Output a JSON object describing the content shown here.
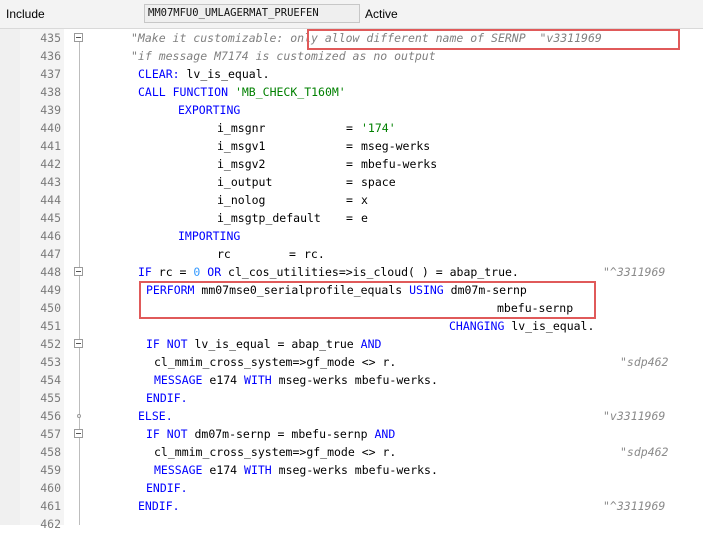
{
  "header": {
    "label": "Include",
    "include_name": "MM07MFU0_UMLAGERMAT_PRUEFEN",
    "status": "Active"
  },
  "colors": {
    "keyword": "#0000ff",
    "string": "#008000",
    "number": "#3399ff",
    "comment": "#808080",
    "highlight": "#e05a5a"
  },
  "editor": {
    "lines": [
      {
        "num": "435",
        "comment": "\"Make it customizable: only allow different name of SERNP  \"v3311969"
      },
      {
        "num": "436",
        "comment": "\"if message M7174 is customized as no output"
      },
      {
        "num": "437",
        "kw1": "CLEAR:",
        "rest": " lv_is_equal."
      },
      {
        "num": "438",
        "kw1": "CALL FUNCTION",
        "str": "'MB_CHECK_T160M'"
      },
      {
        "num": "439",
        "kw1": "EXPORTING"
      },
      {
        "num": "440",
        "param": "i_msgnr",
        "eq": "=",
        "str": "'174'"
      },
      {
        "num": "441",
        "param": "i_msgv1",
        "eq": "=",
        "val": "mseg-werks"
      },
      {
        "num": "442",
        "param": "i_msgv2",
        "eq": "=",
        "val": "mbefu-werks"
      },
      {
        "num": "443",
        "param": "i_output",
        "eq": "=",
        "val": "space"
      },
      {
        "num": "444",
        "param": "i_nolog",
        "eq": "=",
        "val": "x"
      },
      {
        "num": "445",
        "param": "i_msgtp_default",
        "eq": "=",
        "val": "e"
      },
      {
        "num": "446",
        "kw1": "IMPORTING"
      },
      {
        "num": "447",
        "param": "rc",
        "eq": "=",
        "val": "rc."
      },
      {
        "num": "448",
        "kw1": "IF",
        "a": " rc = ",
        "n": "0",
        "kw2": " OR",
        "b": " cl_cos_utilities=>is_cloud( ) = abap_true.",
        "tag": "\"^3311969"
      },
      {
        "num": "449",
        "kw1": "PERFORM",
        "a": " mm07mse0_serialprofile_equals ",
        "kw2": "USING",
        "b": " dm07m-sernp"
      },
      {
        "num": "450",
        "b": "mbefu-sernp"
      },
      {
        "num": "451",
        "kw1": "CHANGING",
        "b": " lv_is_equal."
      },
      {
        "num": "452",
        "kw1": "IF NOT",
        "a": " lv_is_equal = abap_true ",
        "kw2": "AND"
      },
      {
        "num": "453",
        "a": "cl_mmim_cross_system=>gf_mode <> r.",
        "tag": "\"sdp462"
      },
      {
        "num": "454",
        "kw1": "MESSAGE",
        "a": " e174 ",
        "kw2": "WITH",
        "b": " mseg-werks mbefu-werks."
      },
      {
        "num": "455",
        "kw1": "ENDIF."
      },
      {
        "num": "456",
        "kw1": "ELSE.",
        "tag": "\"v3311969"
      },
      {
        "num": "457",
        "kw1": "IF NOT",
        "a": " dm07m-sernp = mbefu-sernp ",
        "kw2": "AND"
      },
      {
        "num": "458",
        "a": "cl_mmim_cross_system=>gf_mode <> r.",
        "tag": "\"sdp462"
      },
      {
        "num": "459",
        "kw1": "MESSAGE",
        "a": " e174 ",
        "kw2": "WITH",
        "b": " mseg-werks mbefu-werks."
      },
      {
        "num": "460",
        "kw1": "ENDIF."
      },
      {
        "num": "461",
        "kw1": "ENDIF.",
        "tag": "\"^3311969"
      },
      {
        "num": "462"
      }
    ]
  }
}
